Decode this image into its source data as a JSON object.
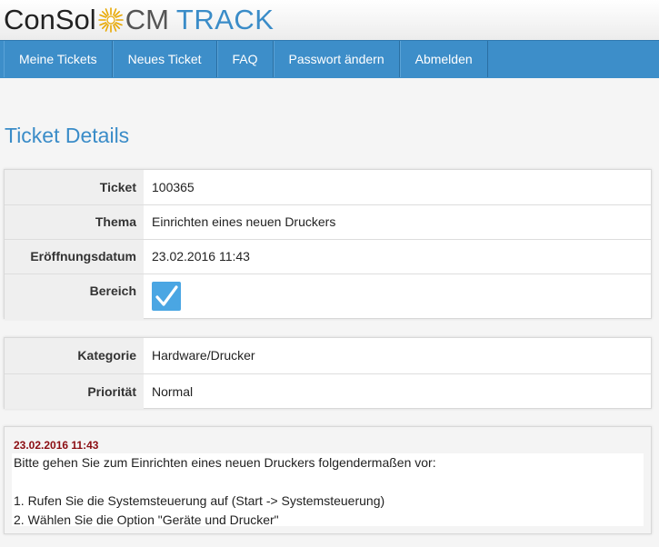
{
  "header": {
    "logo_part1": "ConSol",
    "logo_part2": "CM",
    "logo_part3": "TRACK"
  },
  "nav": {
    "items": [
      {
        "label": "Meine Tickets"
      },
      {
        "label": "Neues Ticket"
      },
      {
        "label": "FAQ"
      },
      {
        "label": "Passwort ändern"
      },
      {
        "label": "Abmelden"
      }
    ]
  },
  "page": {
    "title": "Ticket Details"
  },
  "details": {
    "ticket_label": "Ticket",
    "ticket_value": "100365",
    "thema_label": "Thema",
    "thema_value": "Einrichten eines neuen Druckers",
    "opened_label": "Eröffnungsdatum",
    "opened_value": "23.02.2016 11:43",
    "bereich_label": "Bereich",
    "bereich_icon": "checkmark-icon"
  },
  "classification": {
    "kategorie_label": "Kategorie",
    "kategorie_value": "Hardware/Drucker",
    "prioritaet_label": "Priorität",
    "prioritaet_value": "Normal"
  },
  "message": {
    "date": "23.02.2016 11:43",
    "lines": [
      "Bitte gehen Sie zum Einrichten eines neuen Druckers folgendermaßen vor:",
      "",
      "1. Rufen Sie die Systemsteuerung auf (Start -> Systemsteuerung)",
      "2. Wählen Sie die Option \"Geräte und Drucker\""
    ]
  },
  "colors": {
    "nav_bg": "#3d8ec9",
    "title": "#3a8cc8",
    "message_date": "#8b0d12",
    "check_bg": "#4aa6e3"
  }
}
